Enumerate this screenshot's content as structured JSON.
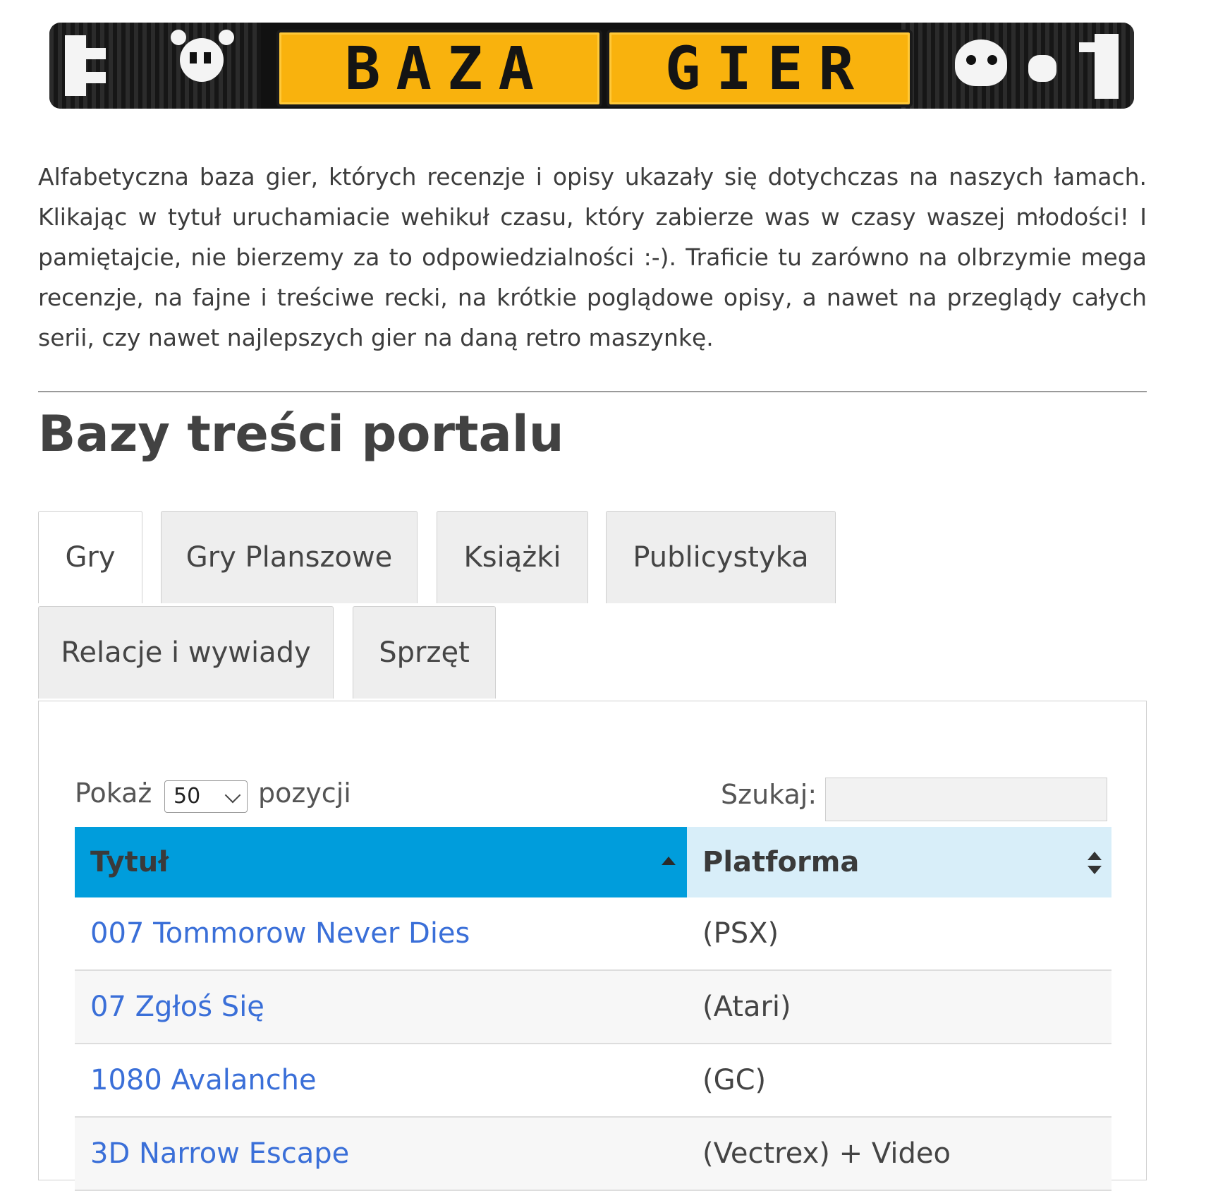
{
  "banner": {
    "word1": "BAZA",
    "word2": "GIER"
  },
  "intro": "Alfabetyczna baza gier, których recenzje i opisy ukazały się dotychczas na naszych łamach. Klikając w tytuł uruchamiacie wehikuł czasu, który zabierze was w czasy waszej młodości! I pamiętajcie, nie bierzemy za to odpowiedzialności :-).  Traficie tu zarówno na olbrzymie mega recenzje, na fajne i treściwe recki, na krótkie poglądowe opisy, a nawet na przeglądy całych serii, czy nawet najlepszych gier na daną retro maszynkę.",
  "section_title": "Bazy treści portalu",
  "tabs": [
    "Gry",
    "Gry Planszowe",
    "Książki",
    "Publicystyka",
    "Relacje i wywiady",
    "Sprzęt"
  ],
  "controls": {
    "show_label": "Pokaż",
    "page_size": "50",
    "entries_label": "pozycji",
    "search_label": "Szukaj:",
    "search_value": ""
  },
  "table": {
    "headers": {
      "title": "Tytuł",
      "platform": "Platforma"
    },
    "rows": [
      {
        "title": "007 Tommorow Never Dies",
        "platform": "(PSX)"
      },
      {
        "title": "07 Zgłoś Się",
        "platform": "(Atari)"
      },
      {
        "title": "1080 Avalanche",
        "platform": "(GC)"
      },
      {
        "title": "3D Narrow Escape",
        "platform": "(Vectrex) + Video"
      }
    ]
  },
  "colors": {
    "accent": "#009ddc",
    "header_inactive": "#d8eef9",
    "link": "#3a6fd8",
    "logo_yellow": "#f9b20d"
  },
  "icons": [
    "sort-ascending-icon",
    "sort-both-icon",
    "chevron-down-icon"
  ]
}
